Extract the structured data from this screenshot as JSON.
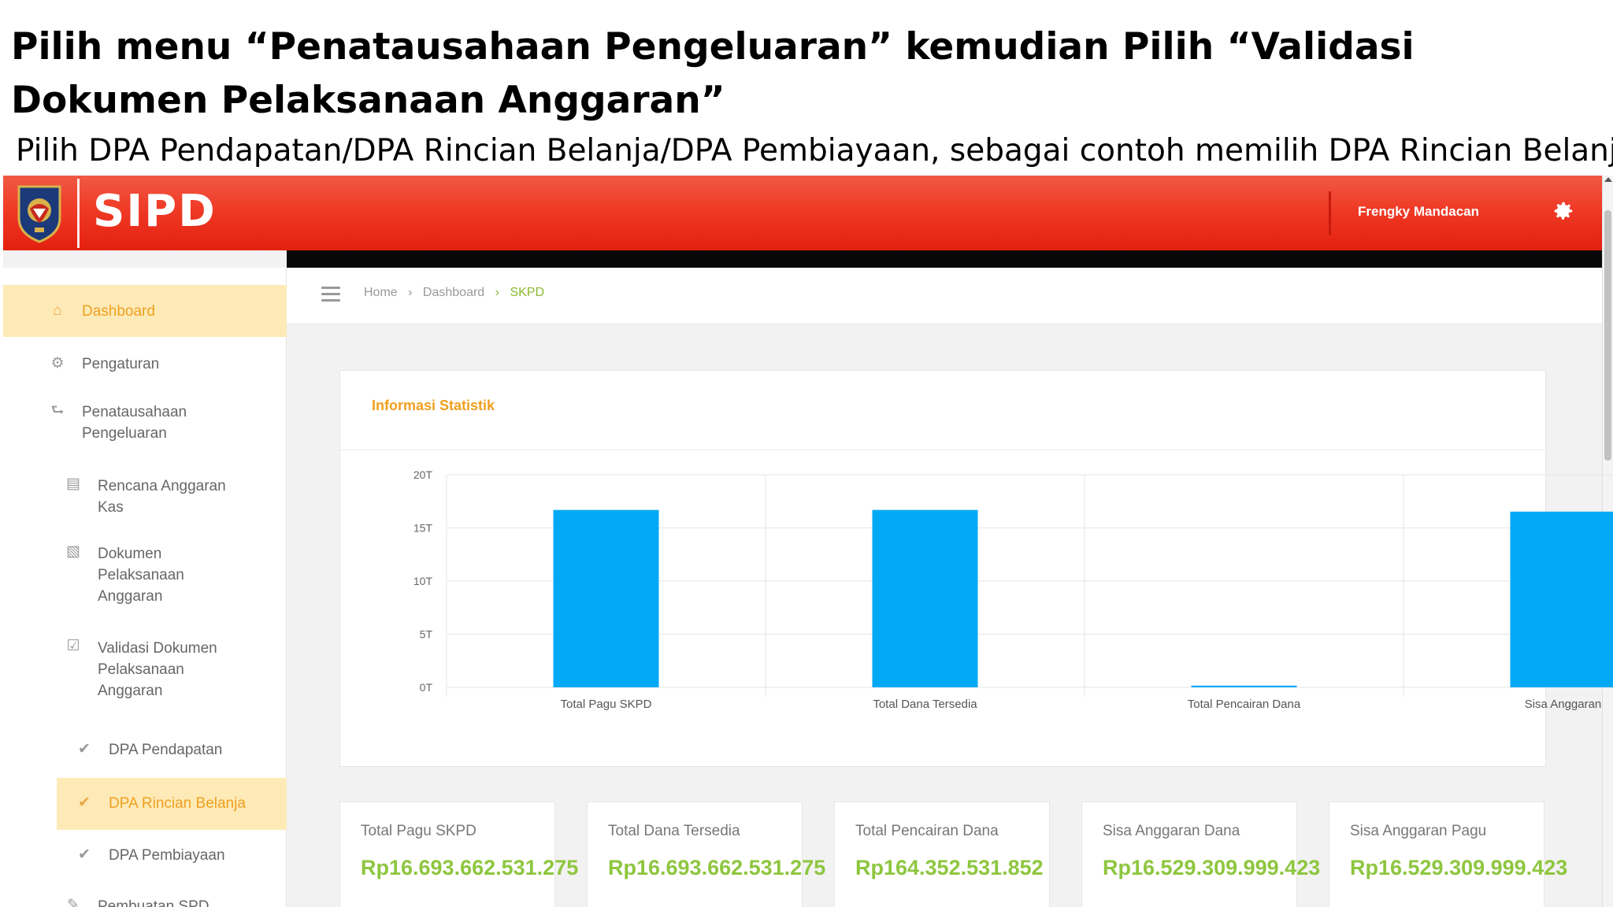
{
  "slide": {
    "title": "Pilih menu “Penatausahaan Pengeluaran” kemudian Pilih “Validasi Dokumen Pelaksanaan Anggaran”",
    "subtitle": "Pilih DPA Pendapatan/DPA Rincian Belanja/DPA Pembiayaan, sebagai contoh memilih DPA Rincian Belanja"
  },
  "header": {
    "logo_text": "SIPD",
    "user_name": "Frengky Mandacan",
    "settings_icon": "gear-icon",
    "brand_color": "#ef3a26"
  },
  "sidebar": {
    "items": [
      {
        "label": "Dashboard",
        "icon": "home-icon",
        "active": true
      },
      {
        "label": "Pengaturan",
        "icon": "gear-icon"
      },
      {
        "label": "Penatausahaan Pengeluaran",
        "icon": "upload-icon"
      },
      {
        "label": "Rencana Anggaran Kas",
        "icon": "credit-card-icon"
      },
      {
        "label": "Dokumen Pelaksanaan Anggaran",
        "icon": "book-icon"
      },
      {
        "label": "Validasi Dokumen Pelaksanaan Anggaran",
        "icon": "checkbox-icon"
      },
      {
        "label": "DPA Pendapatan",
        "icon": "check-icon"
      },
      {
        "label": "DPA Rincian Belanja",
        "icon": "check-icon",
        "active": true
      },
      {
        "label": "DPA Pembiayaan",
        "icon": "check-icon"
      },
      {
        "label": "Pembuatan SPD",
        "icon": "edit-icon"
      }
    ],
    "active_color": "#fdeab7"
  },
  "breadcrumb": {
    "items": [
      "Home",
      "Dashboard",
      "SKPD"
    ]
  },
  "stats": {
    "title": "Informasi Statistik",
    "accent_color": "#f0a020"
  },
  "chart_data": {
    "type": "bar",
    "categories": [
      "Total Pagu SKPD",
      "Total Dana Tersedia",
      "Total Pencairan Dana",
      "Sisa Anggaran"
    ],
    "values": [
      16.69,
      16.69,
      0.16,
      16.53
    ],
    "unit": "T",
    "yticks": [
      "0T",
      "5T",
      "10T",
      "15T",
      "20T"
    ],
    "ylim": [
      0,
      20
    ],
    "bar_color": "#03a9f4",
    "grid": true
  },
  "summary": [
    {
      "label": "Total Pagu SKPD",
      "value": "Rp16.693.662.531.275"
    },
    {
      "label": "Total Dana Tersedia",
      "value": "Rp16.693.662.531.275"
    },
    {
      "label": "Total Pencairan Dana",
      "value": "Rp164.352.531.852"
    },
    {
      "label": "Sisa Anggaran Dana",
      "value": "Rp16.529.309.999.423"
    },
    {
      "label": "Sisa Anggaran Pagu",
      "value": "Rp16.529.309.999.423"
    }
  ],
  "summary_value_color": "#8ec63f"
}
